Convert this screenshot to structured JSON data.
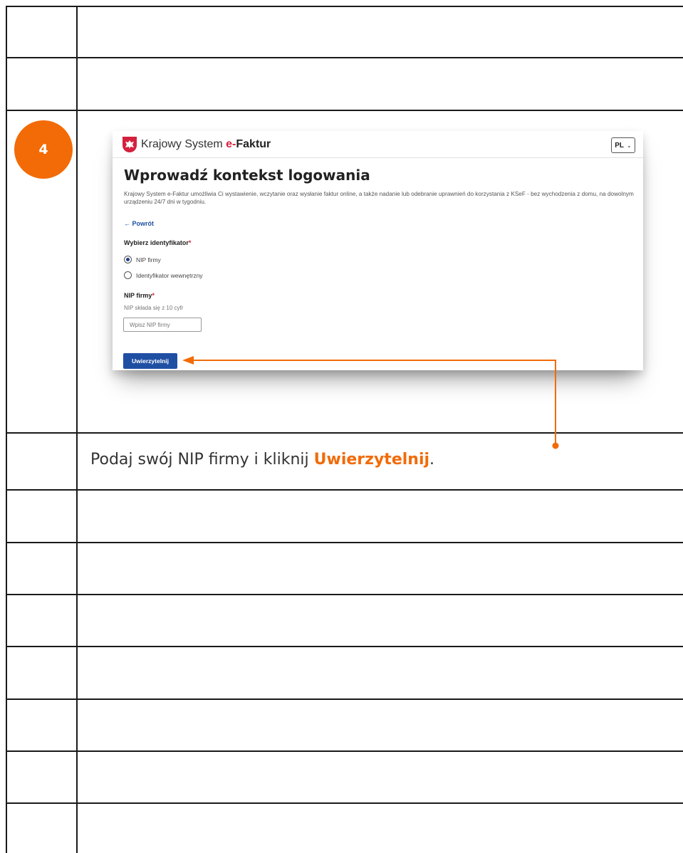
{
  "step": {
    "number": "4"
  },
  "screenshot": {
    "brand_prefix": "Krajowy System ",
    "brand_e": "e-",
    "brand_faktur": "Faktur",
    "language": "PL",
    "title": "Wprowadź kontekst logowania",
    "description": "Krajowy System e-Faktur umożliwia Ci wystawienie, wczytanie oraz wysłanie faktur online, a także nadanie lub odebranie uprawnień do korzystania z KSeF - bez wychodzenia z domu, na dowolnym urządzeniu 24/7 dni w tygodniu.",
    "back_link": "← Powrót",
    "identifier_label": "Wybierz identyfikator",
    "required_mark": "*",
    "options": [
      {
        "label": "NIP firmy",
        "selected": true
      },
      {
        "label": "Identyfikator wewnętrzny",
        "selected": false
      }
    ],
    "nip_label": "NIP firmy",
    "nip_hint": "NIP składa się z 10 cyfr",
    "nip_placeholder": "Wpisz NIP firmy",
    "submit_label": "Uwierzytelnij"
  },
  "instruction": {
    "prefix": "Podaj swój NIP firmy i kliknij ",
    "highlight": "Uwierzytelnij",
    "suffix": "."
  },
  "colors": {
    "accent": "#f26b07",
    "button": "#1f4fa3",
    "brand_red": "#d4213d"
  }
}
